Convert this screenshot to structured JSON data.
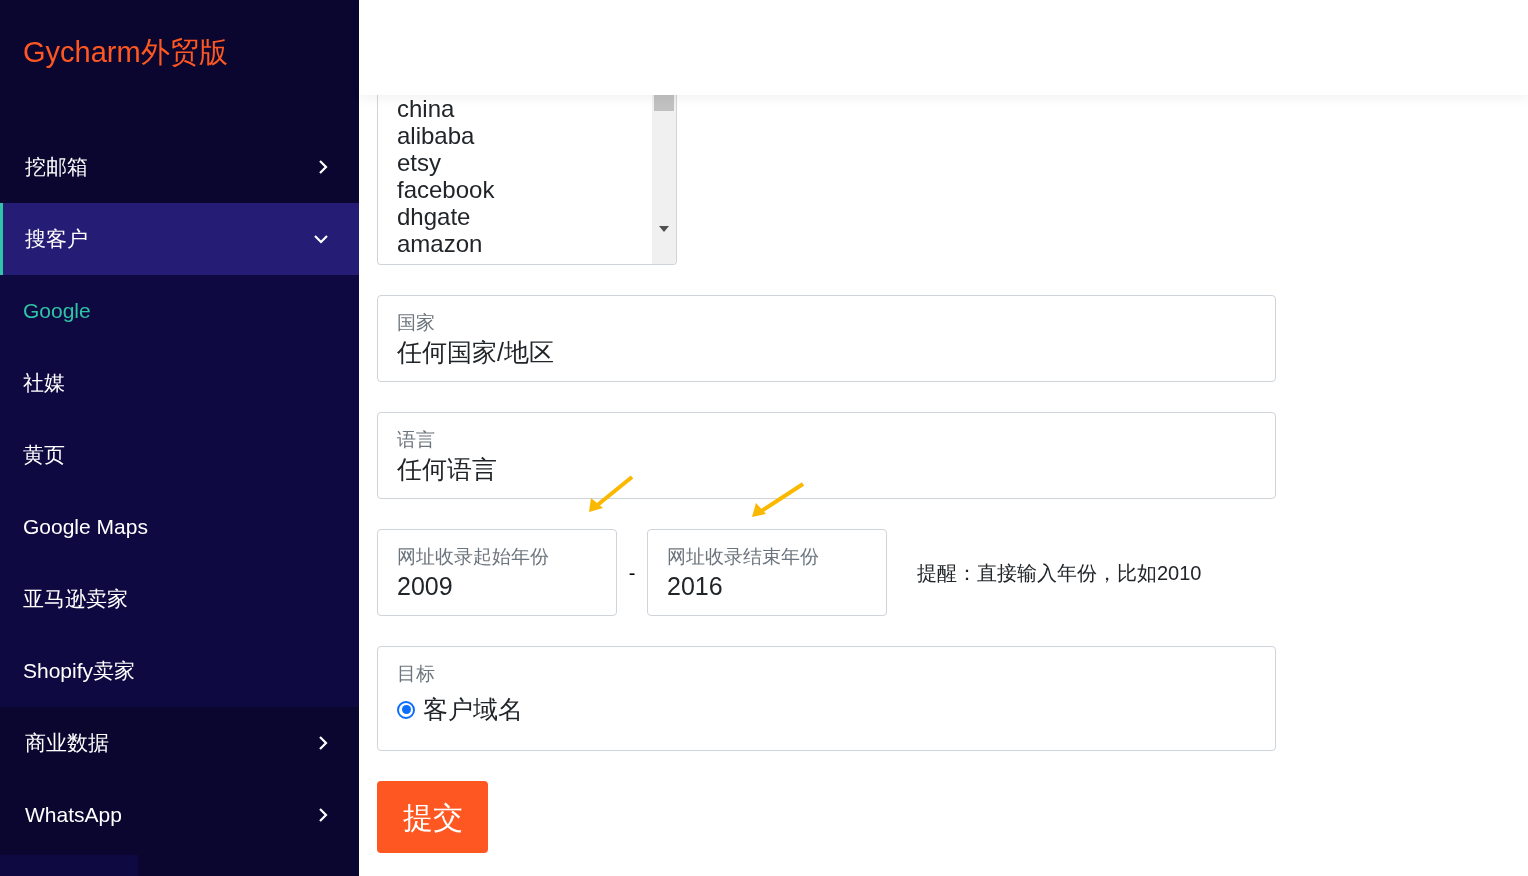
{
  "sidebar": {
    "logo": "Gycharm外贸版",
    "items": [
      {
        "label": "挖邮箱",
        "expanded": false
      },
      {
        "label": "搜客户",
        "expanded": true,
        "children": [
          {
            "label": "Google",
            "selected": true
          },
          {
            "label": "社媒",
            "selected": false
          },
          {
            "label": "黄页",
            "selected": false
          },
          {
            "label": "Google Maps",
            "selected": false
          },
          {
            "label": "亚马逊卖家",
            "selected": false
          },
          {
            "label": "Shopify卖家",
            "selected": false
          }
        ]
      },
      {
        "label": "商业数据",
        "expanded": false
      },
      {
        "label": "WhatsApp",
        "expanded": false
      }
    ]
  },
  "form": {
    "sources": [
      "china",
      "alibaba",
      "etsy",
      "facebook",
      "dhgate",
      "amazon"
    ],
    "country": {
      "label": "国家",
      "value": "任何国家/地区"
    },
    "language": {
      "label": "语言",
      "value": "任何语言"
    },
    "year_start": {
      "label": "网址收录起始年份",
      "value": "2009"
    },
    "separator": "-",
    "year_end": {
      "label": "网址收录结束年份",
      "value": "2016"
    },
    "hint": "提醒：直接输入年份，比如2010",
    "target": {
      "label": "目标",
      "options": [
        {
          "label": "客户域名",
          "selected": true
        }
      ]
    },
    "submit": "提交"
  }
}
